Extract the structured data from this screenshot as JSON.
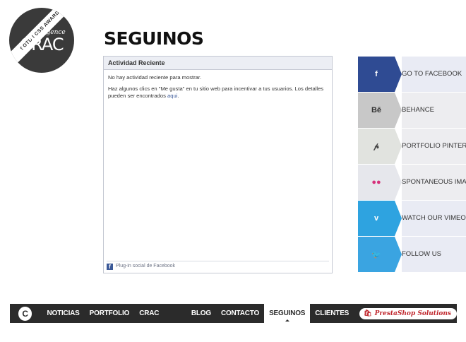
{
  "logo": {
    "banner": "SOTD | CSS AWARDS",
    "word": "CRAC",
    "sub": "Agence"
  },
  "page": {
    "title": "SEGUINOS"
  },
  "facebook_widget": {
    "header": "Actividad Reciente",
    "no_activity": "No hay actividad reciente para mostrar.",
    "hint": "Haz algunos clics en \"Me gusta\" en tu sitio web para incentivar a tus usuarios. Los detalles pueden ser encontrados ",
    "hint_link": "aqui",
    "hint_end": ".",
    "footer": "Plug-in social de Facebook"
  },
  "social": [
    {
      "icon": "facebook-icon",
      "glyph": "f",
      "label": "GO TO FACEBOOK",
      "color": "#2f4b93",
      "fg": "#ffffff",
      "band": "#e9ebf4"
    },
    {
      "icon": "behance-icon",
      "glyph": "Bē",
      "label": "BEHANCE",
      "color": "#c8c8c8",
      "fg": "#333333",
      "band": "#ededf0"
    },
    {
      "icon": "pinterest-icon",
      "glyph": "𝓅",
      "label": "PORTFOLIO PINTEREST",
      "color": "#e1e3df",
      "fg": "#444444",
      "band": "#ededf0"
    },
    {
      "icon": "flickr-icon",
      "glyph": "●●",
      "label": "SPONTANEOUS IMAGES",
      "color": "#e6e7ec",
      "fg": "#d6317a",
      "band": "#ededf0"
    },
    {
      "icon": "vimeo-icon",
      "glyph": "v",
      "label": "WATCH OUR VIMEO",
      "color": "#2ea3e0",
      "fg": "#ffffff",
      "band": "#e9ebf4"
    },
    {
      "icon": "twitter-icon",
      "glyph": "🐦",
      "label": "FOLLOW US",
      "color": "#3aa4e1",
      "fg": "#ffffff",
      "band": "#e9ebf4"
    }
  ],
  "nav": {
    "logo": "C",
    "items": [
      "NOTICIAS",
      "PORTFOLIO",
      "CRAC AGENCE",
      "BLOG",
      "CONTACTO",
      "SEGUINOS",
      "CLIENTES"
    ],
    "active": "SEGUINOS",
    "partner": "PrestaShop Solutions"
  }
}
